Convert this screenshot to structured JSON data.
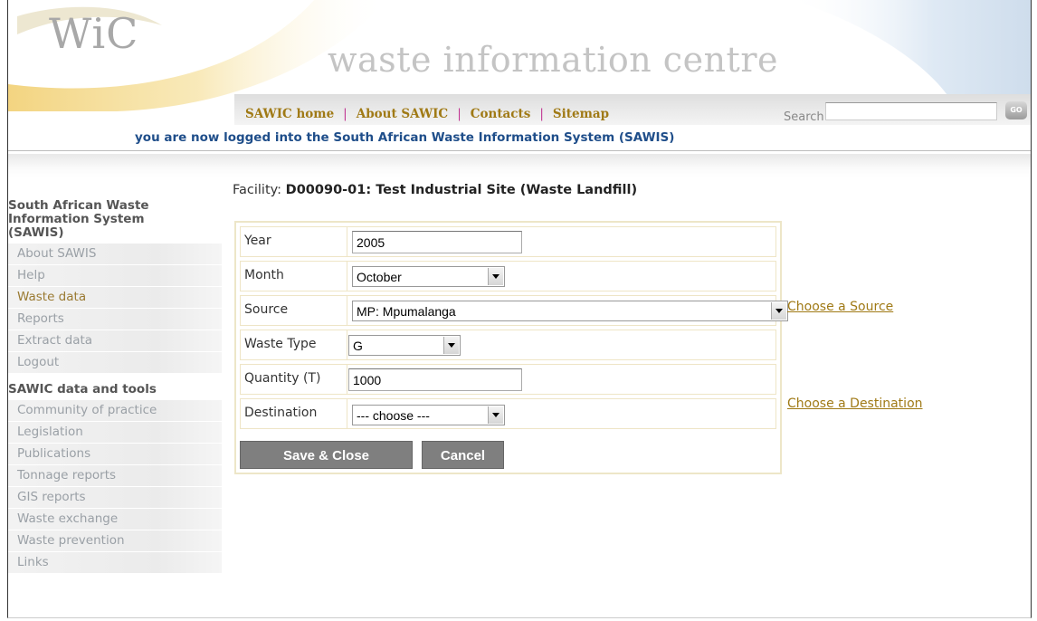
{
  "header": {
    "logo_text": "WiC",
    "site_title": "waste information centre",
    "nav": [
      "SAWIC home",
      "About SAWIC",
      "Contacts",
      "Sitemap"
    ],
    "nav_separator": "|",
    "search_label": "Search",
    "search_value": "",
    "go_label": "GO",
    "logged_in_message": "you are now logged into the South African Waste Information System (SAWIS)"
  },
  "sidebar": {
    "section1_title": "South African Waste Information System (SAWIS)",
    "section1_items": [
      "About SAWIS",
      "Help",
      "Waste data",
      "Reports",
      "Extract data",
      "Logout"
    ],
    "section2_title": "SAWIC data and tools",
    "section2_items": [
      "Community of practice",
      "Legislation",
      "Publications",
      "Tonnage reports",
      "GIS reports",
      "Waste exchange",
      "Waste prevention",
      "Links"
    ]
  },
  "facility": {
    "label": "Facility:",
    "value": "D00090-01: Test Industrial Site (Waste Landfill)"
  },
  "form": {
    "year_label": "Year",
    "year_value": "2005",
    "month_label": "Month",
    "month_value": "October",
    "source_label": "Source",
    "source_value": "MP: Mpumalanga",
    "source_link": "Choose a Source",
    "waste_type_label": "Waste Type",
    "waste_type_value": "G",
    "quantity_label": "Quantity (T)",
    "quantity_value": "1000",
    "destination_label": "Destination",
    "destination_value": "--- choose ---",
    "destination_link": "Choose a Destination",
    "save_label": "Save & Close",
    "cancel_label": "Cancel"
  },
  "colors": {
    "nav_link": "#a07a16",
    "logged_message": "#1f4e8a",
    "button_bg": "#7f7f7f",
    "form_border": "#ede6c8"
  }
}
